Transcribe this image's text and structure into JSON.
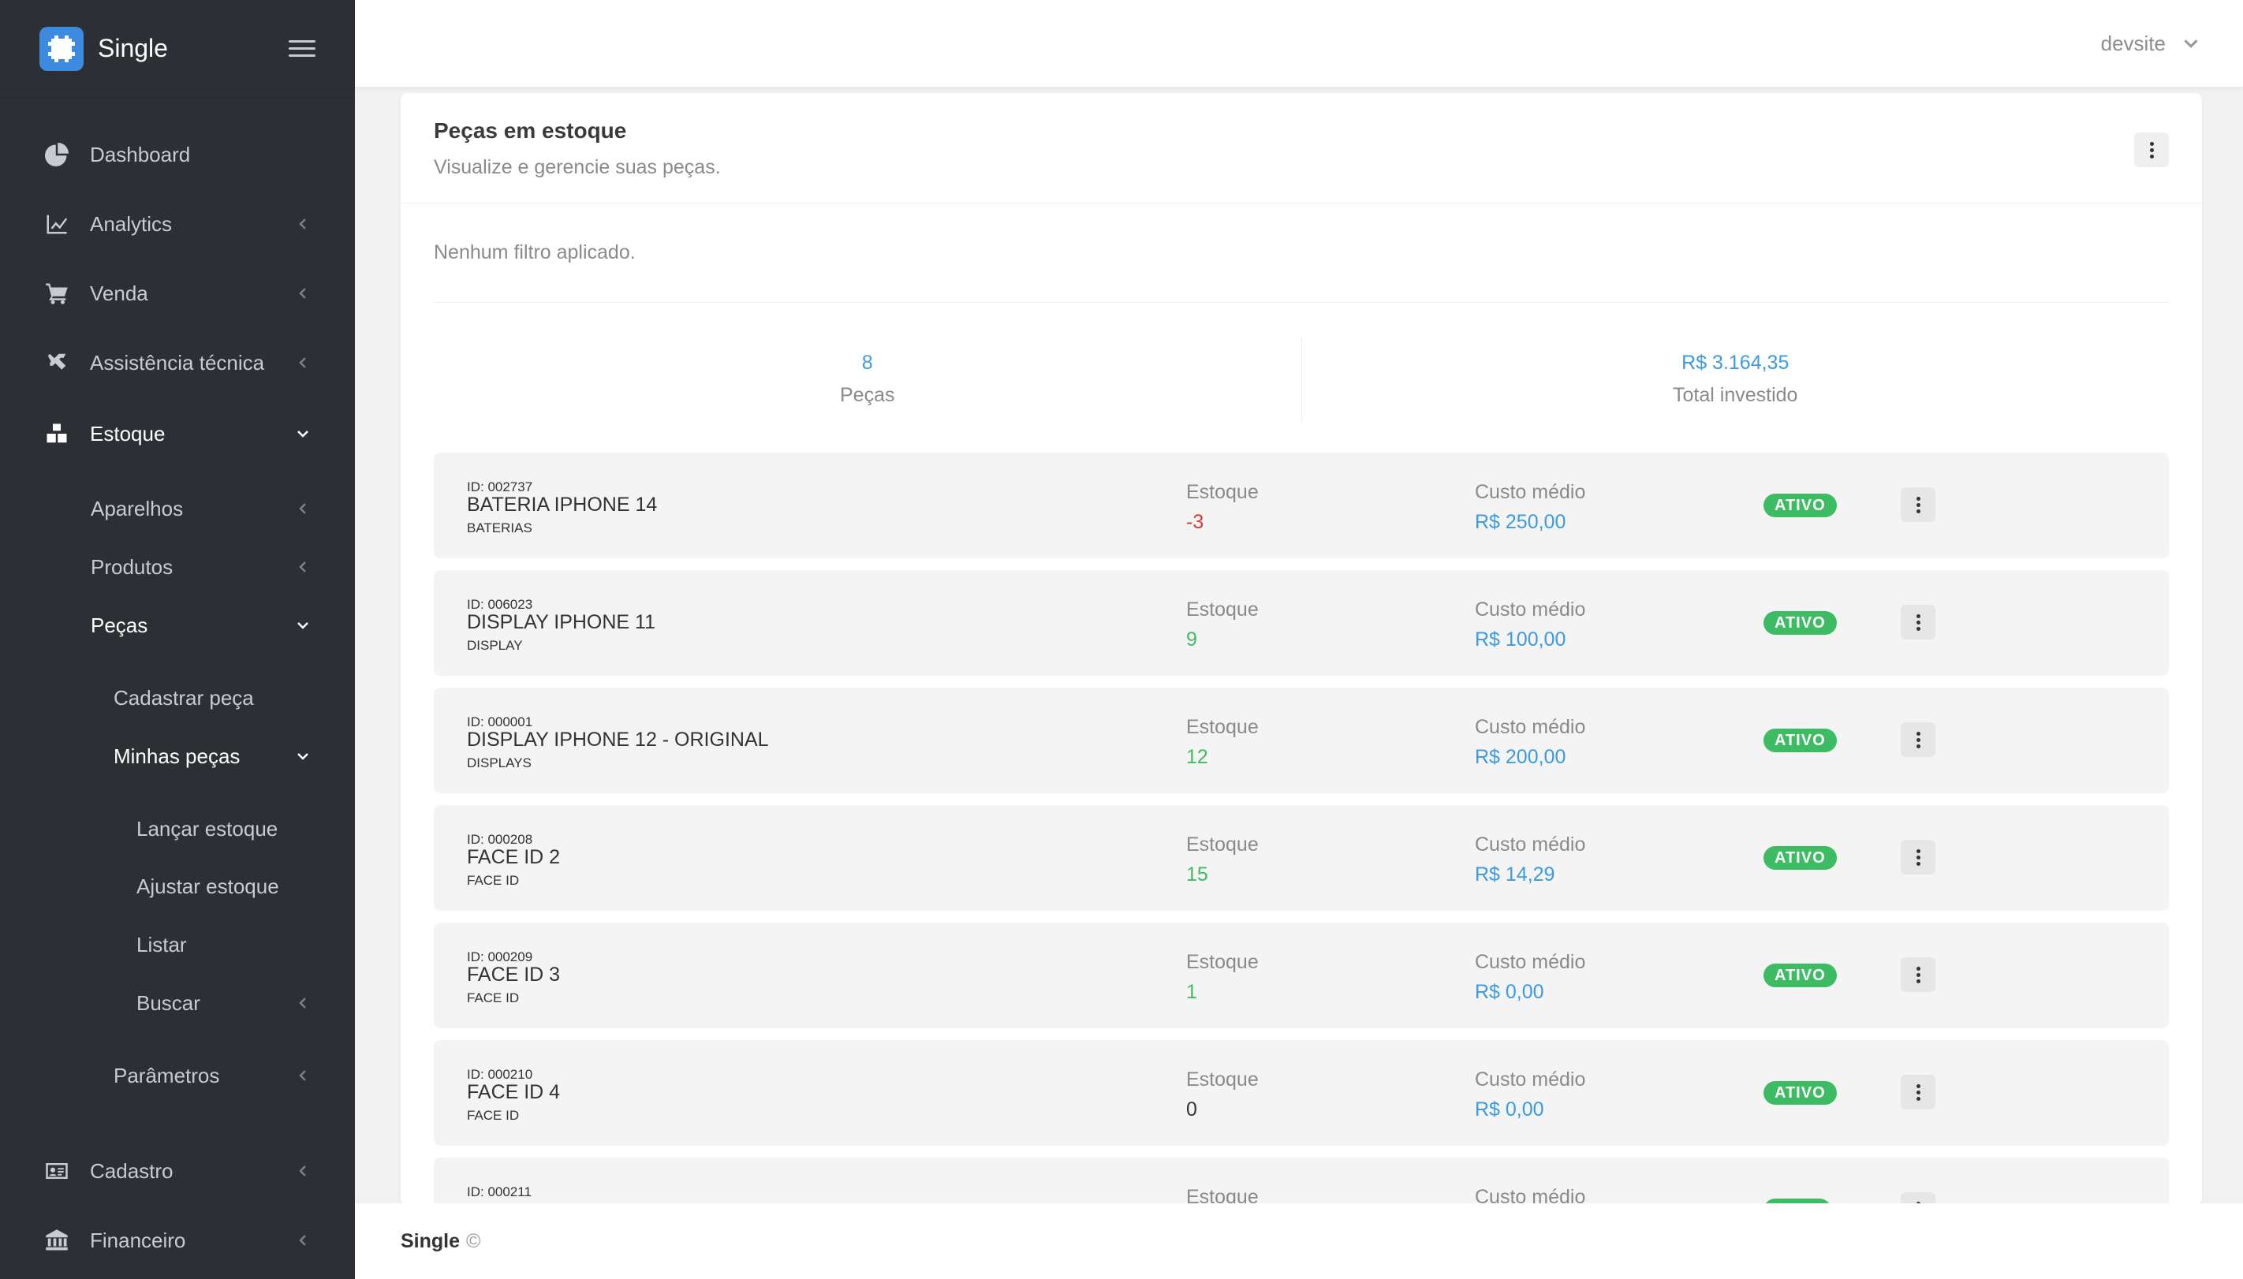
{
  "app": {
    "name": "Single"
  },
  "user": {
    "name": "devsite"
  },
  "sidebar": {
    "items": [
      {
        "key": "dashboard",
        "label": "Dashboard",
        "icon": "pie-chart-icon"
      },
      {
        "key": "analytics",
        "label": "Analytics",
        "icon": "line-chart-icon"
      },
      {
        "key": "venda",
        "label": "Venda",
        "icon": "cart-icon"
      },
      {
        "key": "assistencia",
        "label": "Assistência técnica",
        "icon": "tools-icon"
      },
      {
        "key": "estoque",
        "label": "Estoque",
        "icon": "boxes-icon"
      },
      {
        "key": "aparelhos",
        "label": "Aparelhos"
      },
      {
        "key": "produtos",
        "label": "Produtos"
      },
      {
        "key": "pecas",
        "label": "Peças"
      },
      {
        "key": "cadastrar-peca",
        "label": "Cadastrar peça"
      },
      {
        "key": "minhas-pecas",
        "label": "Minhas peças"
      },
      {
        "key": "lancar-estoque",
        "label": "Lançar estoque"
      },
      {
        "key": "ajustar-estoque",
        "label": "Ajustar estoque"
      },
      {
        "key": "listar",
        "label": "Listar"
      },
      {
        "key": "buscar",
        "label": "Buscar"
      },
      {
        "key": "parametros",
        "label": "Parâmetros"
      },
      {
        "key": "cadastro",
        "label": "Cadastro",
        "icon": "id-card-icon"
      },
      {
        "key": "financeiro",
        "label": "Financeiro",
        "icon": "bank-icon"
      }
    ]
  },
  "card": {
    "title": "Peças em estoque",
    "subtitle": "Visualize e gerencie suas peças.",
    "filter_text": "Nenhum filtro aplicado."
  },
  "summary": {
    "pecas_value": "8",
    "pecas_label": "Peças",
    "total_value": "R$ 3.164,35",
    "total_label": "Total investido"
  },
  "rows": [
    {
      "id": "ID: 002737",
      "name": "BATERIA IPHONE 14",
      "category": "BATERIAS",
      "estoque_label": "Estoque",
      "estoque": "-3",
      "custo_label": "Custo médio",
      "custo": "R$ 250,00",
      "status": "ATIVO"
    },
    {
      "id": "ID: 006023",
      "name": "DISPLAY IPHONE 11",
      "category": "DISPLAY",
      "estoque_label": "Estoque",
      "estoque": "9",
      "custo_label": "Custo médio",
      "custo": "R$ 100,00",
      "status": "ATIVO"
    },
    {
      "id": "ID: 000001",
      "name": "DISPLAY IPHONE 12 - ORIGINAL",
      "category": "DISPLAYS",
      "estoque_label": "Estoque",
      "estoque": "12",
      "custo_label": "Custo médio",
      "custo": "R$ 200,00",
      "status": "ATIVO"
    },
    {
      "id": "ID: 000208",
      "name": "FACE ID 2",
      "category": "FACE ID",
      "estoque_label": "Estoque",
      "estoque": "15",
      "custo_label": "Custo médio",
      "custo": "R$ 14,29",
      "status": "ATIVO"
    },
    {
      "id": "ID: 000209",
      "name": "FACE ID 3",
      "category": "FACE ID",
      "estoque_label": "Estoque",
      "estoque": "1",
      "custo_label": "Custo médio",
      "custo": "R$ 0,00",
      "status": "ATIVO"
    },
    {
      "id": "ID: 000210",
      "name": "FACE ID 4",
      "category": "FACE ID",
      "estoque_label": "Estoque",
      "estoque": "0",
      "custo_label": "Custo médio",
      "custo": "R$ 0,00",
      "status": "ATIVO"
    },
    {
      "id": "ID: 000211",
      "name": "",
      "category": "",
      "estoque_label": "Estoque",
      "estoque": "",
      "custo_label": "Custo médio",
      "custo": "",
      "status": ""
    }
  ],
  "footer": {
    "brand": "Single",
    "copyright": "©"
  },
  "colors": {
    "sidebar": "#2c2f33",
    "accent": "#3b9ae1",
    "success": "#3ebc63",
    "danger": "#d83838"
  }
}
